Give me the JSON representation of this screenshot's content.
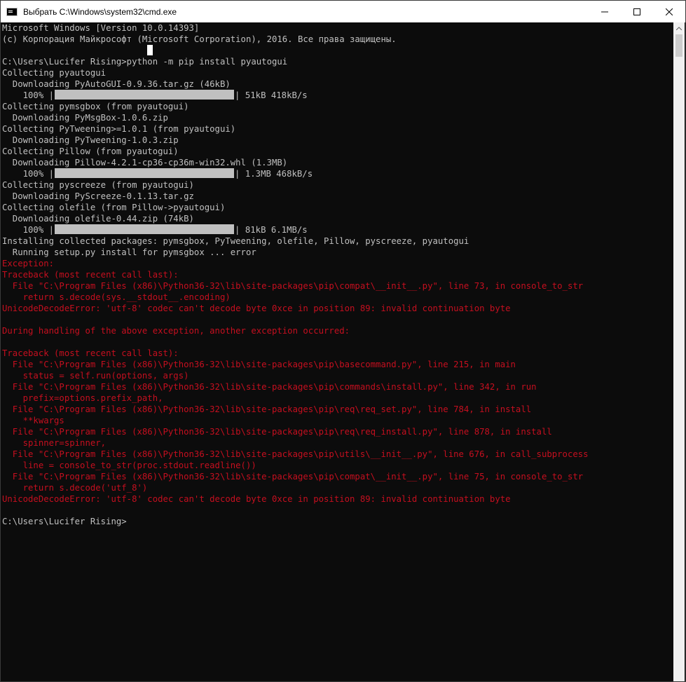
{
  "window": {
    "title": "Выбрать C:\\Windows\\system32\\cmd.exe"
  },
  "console": {
    "lines": [
      {
        "text": "Microsoft Windows [Version 10.0.14393]",
        "err": false
      },
      {
        "text": "(c) Корпорация Майкрософт (Microsoft Corporation), 2016. Все права защищены.",
        "err": false
      },
      {
        "text": "",
        "err": false
      },
      {
        "text": "C:\\Users\\Lucifer Rising>python -m pip install pyautogui",
        "err": false
      },
      {
        "text": "Collecting pyautogui",
        "err": false
      },
      {
        "text": "  Downloading PyAutoGUI-0.9.36.tar.gz (46kB)",
        "err": false
      },
      {
        "text": "",
        "err": false,
        "progress": {
          "pct": "100%",
          "stats": "51kB 418kB/s",
          "fraction": 1.0
        }
      },
      {
        "text": "Collecting pymsgbox (from pyautogui)",
        "err": false
      },
      {
        "text": "  Downloading PyMsgBox-1.0.6.zip",
        "err": false
      },
      {
        "text": "Collecting PyTweening>=1.0.1 (from pyautogui)",
        "err": false
      },
      {
        "text": "  Downloading PyTweening-1.0.3.zip",
        "err": false
      },
      {
        "text": "Collecting Pillow (from pyautogui)",
        "err": false
      },
      {
        "text": "  Downloading Pillow-4.2.1-cp36-cp36m-win32.whl (1.3MB)",
        "err": false
      },
      {
        "text": "",
        "err": false,
        "progress": {
          "pct": "100%",
          "stats": "1.3MB 468kB/s",
          "fraction": 1.0
        }
      },
      {
        "text": "Collecting pyscreeze (from pyautogui)",
        "err": false
      },
      {
        "text": "  Downloading PyScreeze-0.1.13.tar.gz",
        "err": false
      },
      {
        "text": "Collecting olefile (from Pillow->pyautogui)",
        "err": false
      },
      {
        "text": "  Downloading olefile-0.44.zip (74kB)",
        "err": false
      },
      {
        "text": "",
        "err": false,
        "progress": {
          "pct": "100%",
          "stats": "81kB 6.1MB/s",
          "fraction": 1.0
        }
      },
      {
        "text": "Installing collected packages: pymsgbox, PyTweening, olefile, Pillow, pyscreeze, pyautogui",
        "err": false
      },
      {
        "text": "  Running setup.py install for pymsgbox ... error",
        "err": false
      },
      {
        "text": "Exception:",
        "err": true
      },
      {
        "text": "Traceback (most recent call last):",
        "err": true
      },
      {
        "text": "  File \"C:\\Program Files (x86)\\Python36-32\\lib\\site-packages\\pip\\compat\\__init__.py\", line 73, in console_to_str",
        "err": true
      },
      {
        "text": "    return s.decode(sys.__stdout__.encoding)",
        "err": true
      },
      {
        "text": "UnicodeDecodeError: 'utf-8' codec can't decode byte 0xce in position 89: invalid continuation byte",
        "err": true
      },
      {
        "text": "",
        "err": true
      },
      {
        "text": "During handling of the above exception, another exception occurred:",
        "err": true
      },
      {
        "text": "",
        "err": true
      },
      {
        "text": "Traceback (most recent call last):",
        "err": true
      },
      {
        "text": "  File \"C:\\Program Files (x86)\\Python36-32\\lib\\site-packages\\pip\\basecommand.py\", line 215, in main",
        "err": true
      },
      {
        "text": "    status = self.run(options, args)",
        "err": true
      },
      {
        "text": "  File \"C:\\Program Files (x86)\\Python36-32\\lib\\site-packages\\pip\\commands\\install.py\", line 342, in run",
        "err": true
      },
      {
        "text": "    prefix=options.prefix_path,",
        "err": true
      },
      {
        "text": "  File \"C:\\Program Files (x86)\\Python36-32\\lib\\site-packages\\pip\\req\\req_set.py\", line 784, in install",
        "err": true
      },
      {
        "text": "    **kwargs",
        "err": true
      },
      {
        "text": "  File \"C:\\Program Files (x86)\\Python36-32\\lib\\site-packages\\pip\\req\\req_install.py\", line 878, in install",
        "err": true
      },
      {
        "text": "    spinner=spinner,",
        "err": true
      },
      {
        "text": "  File \"C:\\Program Files (x86)\\Python36-32\\lib\\site-packages\\pip\\utils\\__init__.py\", line 676, in call_subprocess",
        "err": true
      },
      {
        "text": "    line = console_to_str(proc.stdout.readline())",
        "err": true
      },
      {
        "text": "  File \"C:\\Program Files (x86)\\Python36-32\\lib\\site-packages\\pip\\compat\\__init__.py\", line 75, in console_to_str",
        "err": true
      },
      {
        "text": "    return s.decode('utf_8')",
        "err": true
      },
      {
        "text": "UnicodeDecodeError: 'utf-8' codec can't decode byte 0xce in position 89: invalid continuation byte",
        "err": true
      },
      {
        "text": "",
        "err": false
      },
      {
        "text": "C:\\Users\\Lucifer Rising>",
        "err": false
      }
    ]
  },
  "colors": {
    "background": "#0c0c0c",
    "text": "#c0c0c0",
    "error_text": "#c50f1f",
    "progress_bar": "#c0c0c0"
  },
  "icons": {
    "app": "cmd-app-icon",
    "minimize": "minimize-icon",
    "maximize": "maximize-icon",
    "close": "close-icon",
    "scroll_up": "scroll-up-arrow-icon"
  }
}
